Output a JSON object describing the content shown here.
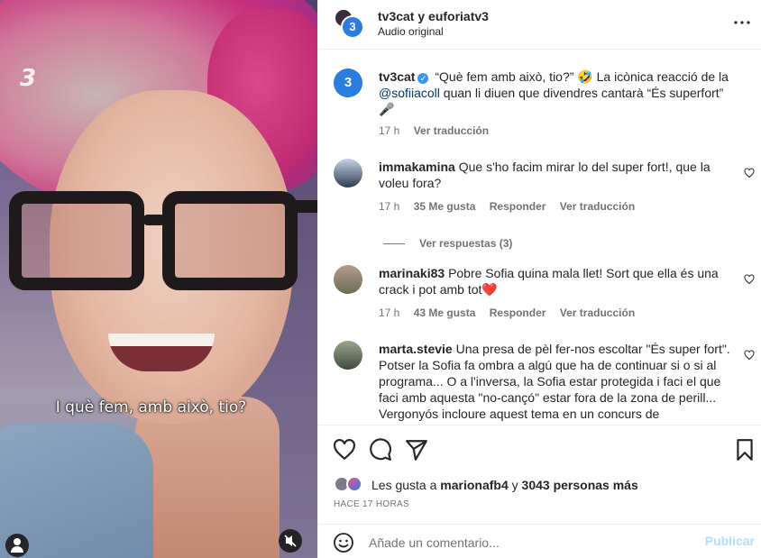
{
  "media": {
    "subtitle": "I què fem, amb això, tio?",
    "brand": "3"
  },
  "header": {
    "title": "tv3cat y euforiatv3",
    "subtitle": "Audio original"
  },
  "caption": {
    "user": "tv3cat",
    "text_before": "“Què fem amb això, tio?” 🤣 La icònica reacció de la",
    "mention": "@sofiiacoll",
    "text_after": "quan li diuen que divendres cantarà “És superfort” 🎤",
    "time": "17 h",
    "translate": "Ver traducción"
  },
  "comments": [
    {
      "user": "immakamina",
      "text": "Que s'ho facim mirar lo del super fort!, que la voleu fora?",
      "time": "17 h",
      "likes": "35 Me gusta",
      "reply": "Responder",
      "translate": "Ver traducción"
    },
    {
      "user": "marinaki83",
      "text": "Pobre Sofia quina mala llet! Sort que ella és una crack i pot amb tot❤️",
      "time": "17 h",
      "likes": "43 Me gusta",
      "reply": "Responder",
      "translate": "Ver traducción"
    },
    {
      "user": "marta.stevie",
      "text": "Una presa de pèl fer-nos escoltar \"És super fort\". Potser la Sofia fa ombra a algú que ha de continuar si o si al programa... O a l'inversa, la Sofia estar protegida i faci el que faci amb aquesta \"no-cançó\" estar fora de la zona de perill... Vergonyós incloure aquest tema en un concurs de"
    }
  ],
  "view_replies": "Ver respuestas (3)",
  "likes": {
    "prefix": "Les gusta a",
    "user": "marionafb4",
    "conj": "y",
    "count": "3043 personas más"
  },
  "time_ago": "HACE 17 HORAS",
  "add_comment": {
    "placeholder": "Añade un comentario...",
    "post": "Publicar"
  },
  "colors": {
    "accent": "#0095f6",
    "post_disabled": "#b3dbff",
    "heart": "#ed4956"
  }
}
